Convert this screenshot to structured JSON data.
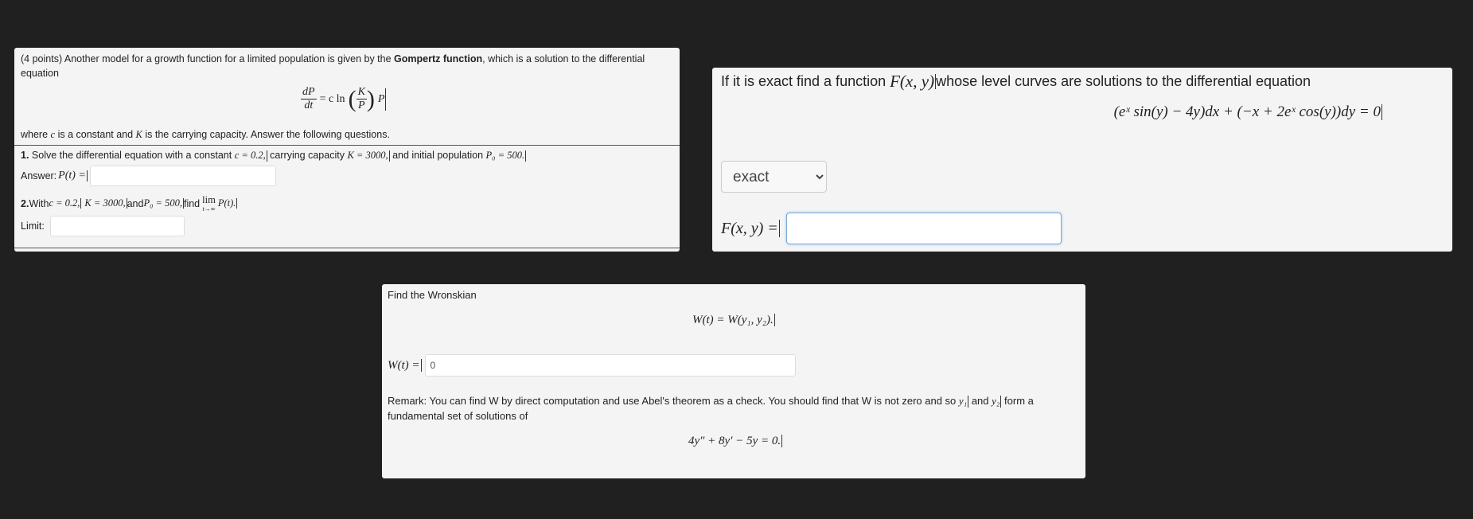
{
  "panel1": {
    "intro_prefix": "(4 points) Another model for a growth function for a limited population is given by the ",
    "intro_bold": "Gompertz function",
    "intro_suffix": ", which is a solution to the differential equation",
    "eq_lhs_num": "dP",
    "eq_lhs_den": "dt",
    "eq_mid": "= c ln",
    "eq_frac_num": "K",
    "eq_frac_den": "P",
    "eq_tail": "P",
    "where_a": "where ",
    "where_c": "c",
    "where_b": " is a constant and ",
    "where_k": "K",
    "where_c2": " is the carrying capacity. Answer the following questions.",
    "q1_label": "1.",
    "q1_text": " Solve the differential equation with a constant ",
    "q1_c": "c = 0.2,",
    "q1_mid": " carrying capacity ",
    "q1_k": "K = 3000,",
    "q1_mid2": " and initial population ",
    "q1_p0": "P₀ = 500.",
    "answer_label": "Answer: ",
    "answer_math": "P(t) =",
    "answer_value": "",
    "q2_label": "2.",
    "q2_text": " With ",
    "q2_c": "c = 0.2,",
    "q2_k": "K = 3000,",
    "q2_and": " and ",
    "q2_p0": "P₀ = 500,",
    "q2_find": " find ",
    "q2_lim": "lim",
    "q2_lim_sub": "t→∞",
    "q2_pt": "P(t).",
    "limit_label": "Limit:",
    "limit_value": ""
  },
  "panel2": {
    "head_prefix": "If it is exact find a function ",
    "head_math": "F(x, y)",
    "head_suffix": " whose level curves are solutions to the differential equation",
    "equation": "(eˣ sin(y) − 4y)dx + (−x + 2eˣ cos(y))dy = 0",
    "select_value": "exact",
    "f_label": "F(x, y) =",
    "f_value": ""
  },
  "panel3": {
    "title": "Find the Wronskian",
    "equation": "W(t) = W(y₁, y₂).",
    "w_label": "W(t) =",
    "w_value": "0",
    "remark_a": "Remark: You can find W by direct computation and use Abel's theorem as a check. You should find that W is not zero and so ",
    "remark_y1": "y₁",
    "remark_and": " and ",
    "remark_y2": "y₂",
    "remark_b": " form a fundamental set of solutions of",
    "ode": "4y″ + 8y′ − 5y = 0."
  }
}
